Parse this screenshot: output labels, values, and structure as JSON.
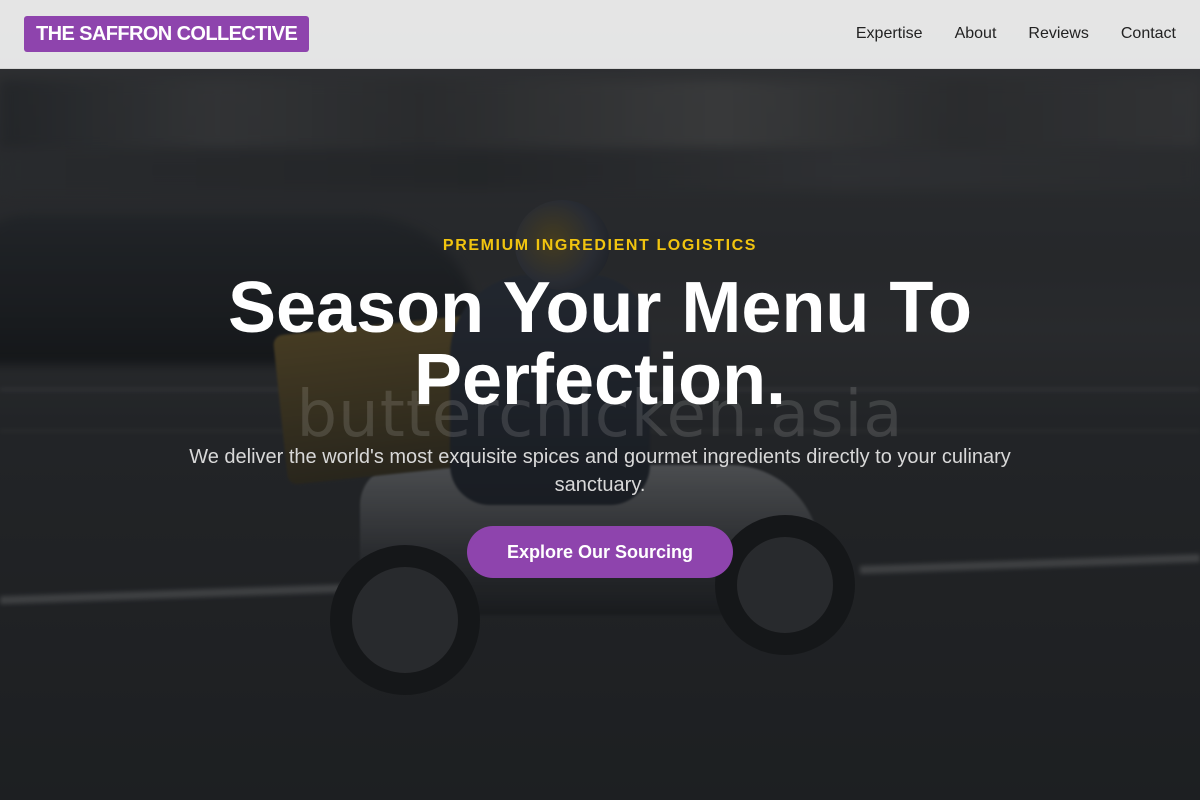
{
  "header": {
    "logo": "THE SAFFRON COLLECTIVE",
    "nav": [
      {
        "label": "Expertise"
      },
      {
        "label": "About"
      },
      {
        "label": "Reviews"
      },
      {
        "label": "Contact"
      }
    ]
  },
  "hero": {
    "eyebrow": "PREMIUM INGREDIENT LOGISTICS",
    "headline": "Season Your Menu To Perfection.",
    "subhead": "We deliver the world's most exquisite spices and gourmet ingredients directly to your culinary sanctuary.",
    "cta_label": "Explore Our Sourcing",
    "watermark": "butterchicken.asia"
  },
  "colors": {
    "brand": "#8e44ad",
    "accent": "#f1c40f"
  }
}
